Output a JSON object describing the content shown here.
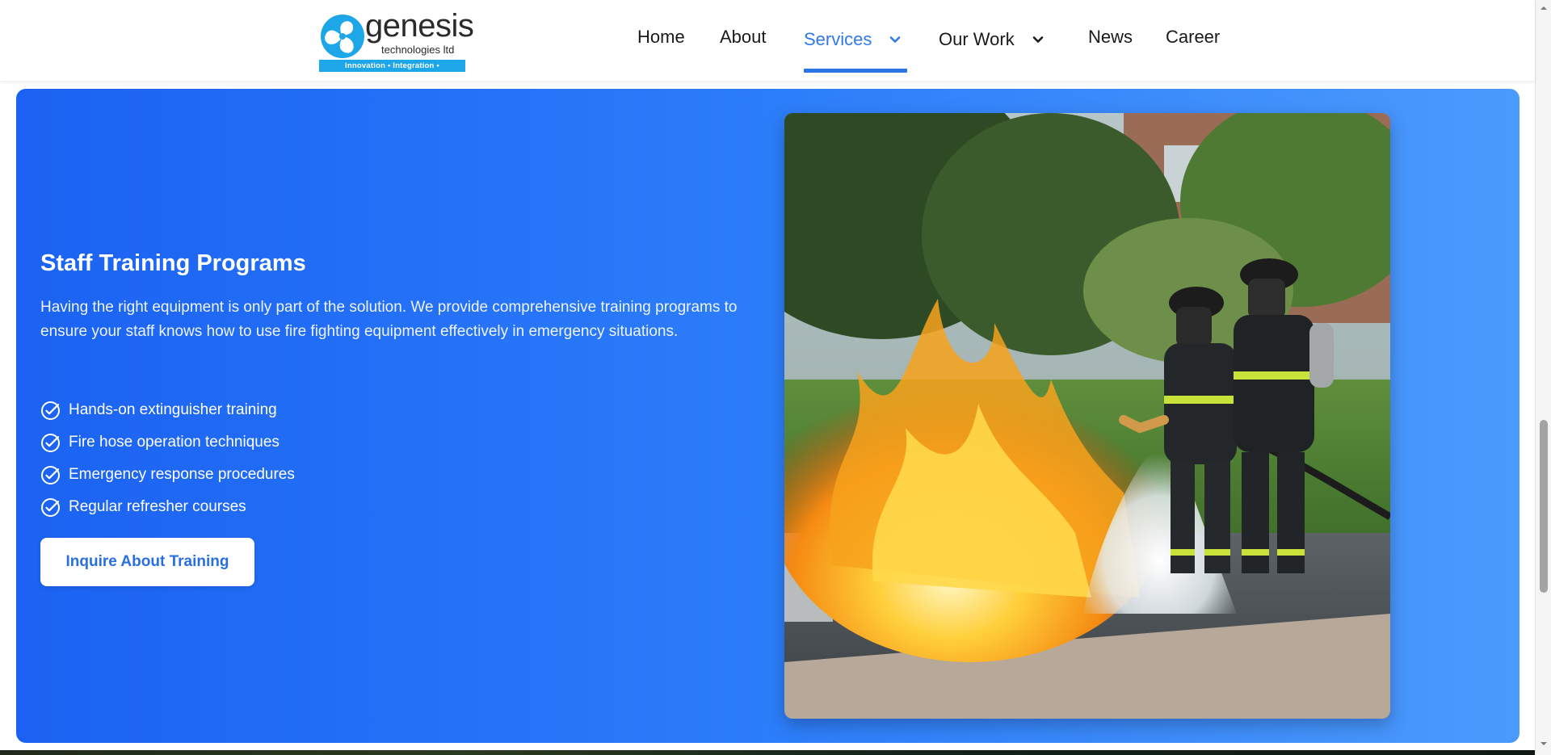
{
  "brand": {
    "name": "genesis",
    "subtitle": "technologies ltd",
    "tagline": "Innovation • Integration • Implementation",
    "colors": {
      "primary": "#1ea7e8",
      "accent": "#2a74e4"
    }
  },
  "nav": {
    "items": [
      {
        "label": "Home",
        "has_dropdown": false,
        "active": false
      },
      {
        "label": "About",
        "has_dropdown": false,
        "active": false
      },
      {
        "label": "Services",
        "has_dropdown": true,
        "active": true
      },
      {
        "label": "Our Work",
        "has_dropdown": true,
        "active": false
      },
      {
        "label": "News",
        "has_dropdown": false,
        "active": false
      },
      {
        "label": "Career",
        "has_dropdown": false,
        "active": false
      }
    ],
    "dropdown_icon": "chevron-down-icon"
  },
  "section": {
    "heading": "Staff Training Programs",
    "description": "Having the right equipment is only part of the solution. We provide comprehensive training programs to ensure your staff knows how to use fire fighting equipment effectively in emergency situations.",
    "features": [
      "Hands-on extinguisher training",
      "Fire hose operation techniques",
      "Emergency response procedures",
      "Regular refresher courses"
    ],
    "feature_icon": "check-circle-icon",
    "cta_label": "Inquire About Training",
    "background_colors": [
      "#1b62f2",
      "#4b9afd"
    ]
  },
  "photo": {
    "subject": "firefighters-spraying-hose-icon"
  }
}
